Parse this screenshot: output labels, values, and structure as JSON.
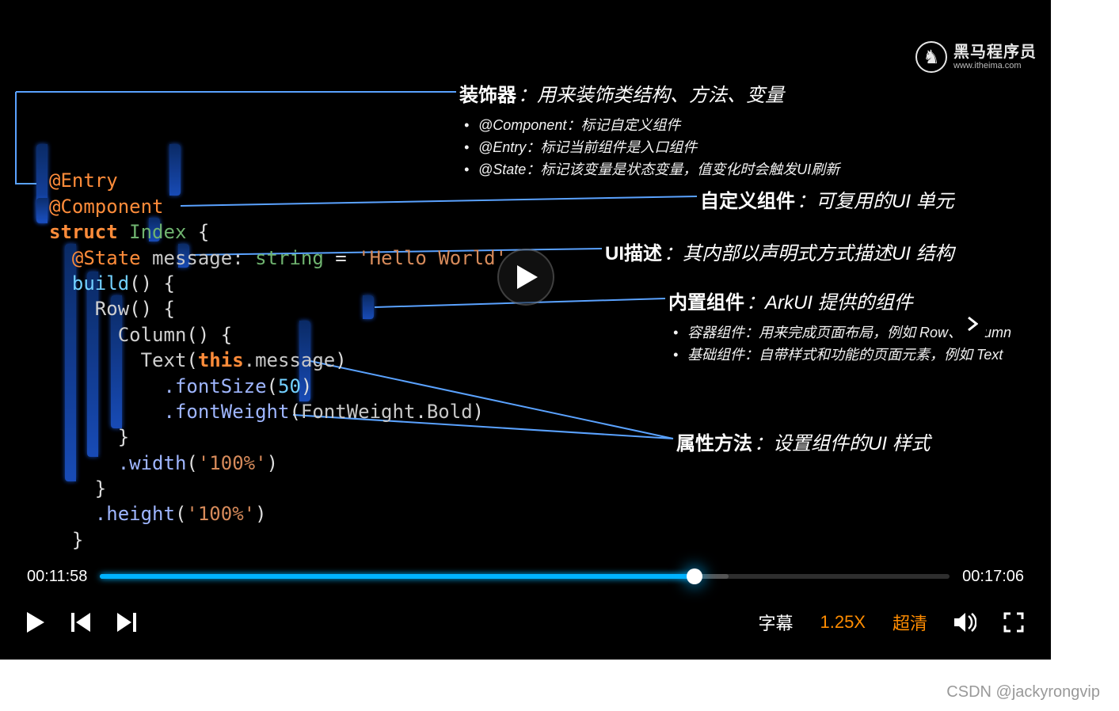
{
  "watermark": {
    "name": "黑马程序员",
    "url": "www.itheima.com"
  },
  "code": {
    "entry": "@Entry",
    "component": "@Component",
    "struct": "struct",
    "index": "Index",
    "lbrace": " {",
    "state": "@State",
    "msg": " message: ",
    "string": "string",
    "eq": " = ",
    "hello": "'Hello World'",
    "build": "build",
    "parens": "() {",
    "rowc": "Row",
    "rowp": "() {",
    "colc": "Column",
    "colp": "() {",
    "text": "Text",
    "textopen": "(",
    "this": "this",
    "dotmsg": ".message",
    "textclose": ")",
    "fsize": ".fontSize",
    "fsizeopen": "(",
    "fifty": "50",
    "fsizeclose": ")",
    "fweight": ".fontWeight",
    "fweightopen": "(",
    "fw_enum": "FontWeight",
    "fw_dot": ".",
    "fw_bold": "Bold",
    "fweightclose": ")",
    "rb1": "}",
    "width": ".width",
    "wopen": "(",
    "wval": "'100%'",
    "wclose": ")",
    "rb2": "}",
    "height": ".height",
    "hopen": "(",
    "hval": "'100%'",
    "hclose": ")",
    "rb3": "}",
    "rb4": "}"
  },
  "ann": {
    "decorator": {
      "title": "装饰器",
      "desc": "：用来装饰类结构、方法、变量",
      "items": [
        "@Component：标记自定义组件",
        "@Entry：标记当前组件是入口组件",
        "@State：标记该变量是状态变量，值变化时会触发UI刷新"
      ]
    },
    "custom": {
      "title": "自定义组件",
      "desc": "：可复用的UI 单元"
    },
    "uidesc": {
      "title": "UI描述",
      "desc": "：其内部以声明式方式描述UI 结构"
    },
    "builtin": {
      "title": "内置组件",
      "desc": "：ArkUI 提供的组件",
      "items": [
        "容器组件：用来完成页面布局，例如 Row、Column",
        "基础组件：自带样式和功能的页面元素，例如 Text"
      ]
    },
    "attr": {
      "title": "属性方法",
      "desc": "：设置组件的UI 样式"
    }
  },
  "player": {
    "current": "00:11:58",
    "duration": "00:17:06",
    "progress_pct": 70,
    "subtitle_label": "字幕",
    "speed_label": "1.25X",
    "quality_label": "超清"
  },
  "csdn": "CSDN @jackyrongvip"
}
